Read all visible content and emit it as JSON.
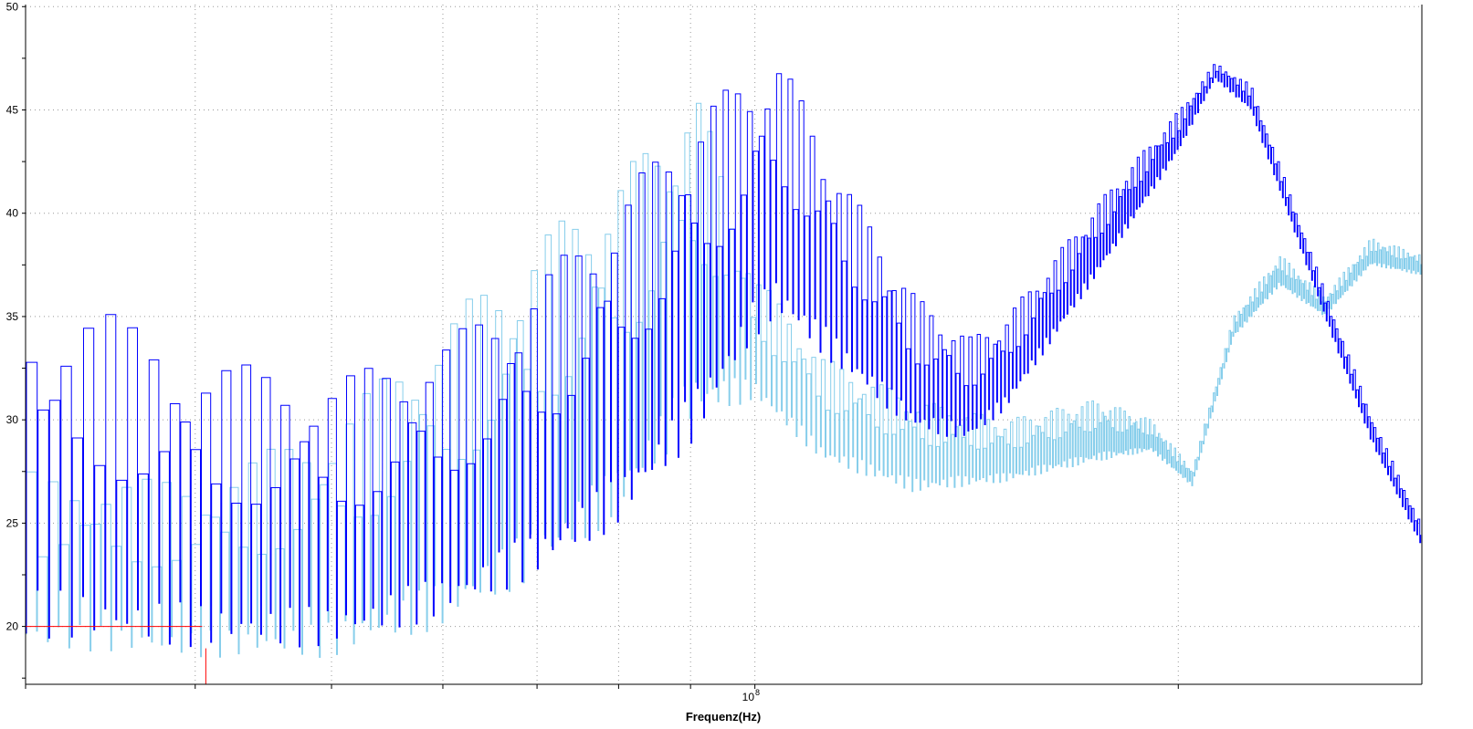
{
  "chart_data": {
    "type": "line",
    "title": "",
    "xlabel": "Frequenz(Hz)",
    "ylabel": "",
    "xscale": "log",
    "xlim_hz": [
      30300000,
      298000000
    ],
    "ylim": [
      17.2,
      50.1
    ],
    "y_ticks": [
      20,
      25,
      30,
      35,
      40,
      45,
      50
    ],
    "x_tick_labels": [
      {
        "value_hz": 100000000,
        "base": "10",
        "exp": "8"
      }
    ],
    "x_gridlines_hz": [
      40000000,
      50000000,
      60000000,
      70000000,
      80000000,
      90000000,
      100000000,
      200000000
    ],
    "grid": true,
    "legend": "none",
    "cursor": {
      "freq_hz": 40700000,
      "level": 20,
      "color": "#ff0000"
    },
    "series": [
      {
        "name": "light",
        "color": "#87ceeb",
        "envelope": {
          "freq_mhz": [
            30.3,
            40.0,
            50.0,
            60.3,
            70.4,
            80.3,
            90.5,
            100,
            111.7,
            129.7,
            150.6,
            175,
            191.3,
            204.5,
            218.7,
            236,
            254,
            274,
            298
          ],
          "lower": [
            19,
            18.5,
            18.5,
            20,
            22.5,
            25.5,
            30,
            31,
            28,
            26.5,
            27,
            28,
            28.5,
            26.8,
            34,
            36.5,
            35,
            37.5,
            37
          ],
          "upper": [
            27.5,
            27,
            30,
            35,
            39,
            42,
            46,
            37,
            33,
            31,
            30,
            31,
            30,
            27.6,
            35,
            38,
            36,
            38.8,
            38
          ]
        }
      },
      {
        "name": "dark",
        "color": "#0000ff",
        "envelope": {
          "freq_mhz": [
            30.3,
            33.8,
            40.0,
            50.0,
            60.3,
            70.4,
            80.3,
            90.5,
            100,
            103.6,
            116.8,
            129.7,
            141.8,
            150.6,
            175,
            200,
            212.3,
            225,
            254,
            274,
            298
          ],
          "lower": [
            19.5,
            19.3,
            19,
            19,
            20.5,
            22.5,
            25,
            29,
            34,
            35,
            32,
            29.5,
            29,
            30.5,
            37,
            43,
            46.5,
            45,
            35,
            29,
            23.8
          ],
          "upper": [
            35,
            35.5,
            33,
            32,
            34,
            37,
            41,
            45,
            47,
            47.6,
            41,
            36,
            34,
            35,
            40.5,
            45,
            47.3,
            46.2,
            36.2,
            30.2,
            24.8
          ]
        }
      }
    ]
  }
}
